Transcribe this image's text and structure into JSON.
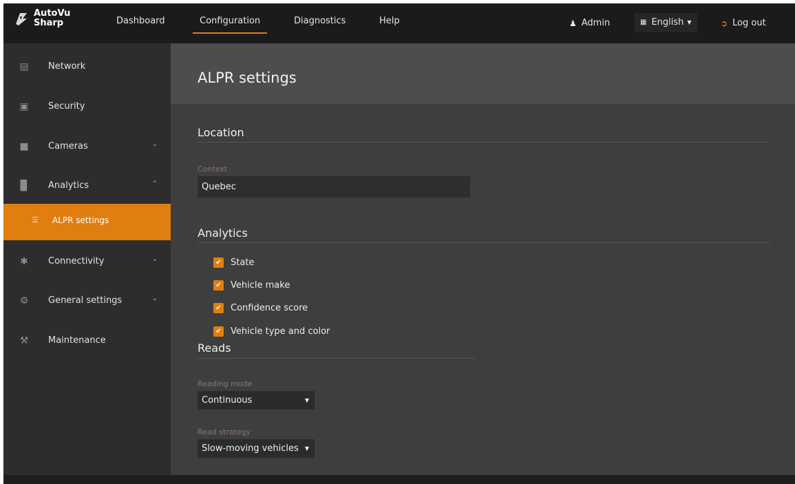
{
  "brand": {
    "line1": "AutoVu",
    "line2": "Sharp"
  },
  "nav": {
    "dashboard": "Dashboard",
    "configuration": "Configuration",
    "diagnostics": "Diagnostics",
    "help": "Help",
    "active": "Configuration"
  },
  "topright": {
    "user": "Admin",
    "language": "English",
    "logout": "Log out"
  },
  "sidebar": {
    "items": [
      {
        "label": "Network",
        "icon": "network-icon"
      },
      {
        "label": "Security",
        "icon": "security-icon"
      },
      {
        "label": "Cameras",
        "icon": "camera-icon",
        "chevron": "down"
      },
      {
        "label": "Analytics",
        "icon": "analytics-icon",
        "chevron": "up"
      },
      {
        "label": "ALPR settings",
        "icon": "sliders-icon",
        "selected": true
      },
      {
        "label": "Connectivity",
        "icon": "connectivity-icon",
        "chevron": "down"
      },
      {
        "label": "General settings",
        "icon": "gear-icon",
        "chevron": "down"
      },
      {
        "label": "Maintenance",
        "icon": "wrench-icon"
      }
    ]
  },
  "main": {
    "title": "ALPR settings",
    "location": {
      "heading": "Location",
      "context_label": "Context",
      "context_value": "Quebec"
    },
    "analytics": {
      "heading": "Analytics",
      "options": [
        {
          "label": "State",
          "checked": true
        },
        {
          "label": "Vehicle make",
          "checked": true
        },
        {
          "label": "Confidence score",
          "checked": true
        },
        {
          "label": "Vehicle type and color",
          "checked": true
        }
      ]
    },
    "reads": {
      "heading": "Reads",
      "reading_mode_label": "Reading mode",
      "reading_mode_value": "Continuous",
      "read_strategy_label": "Read strategy",
      "read_strategy_value": "Slow-moving vehicles"
    }
  },
  "colors": {
    "accent": "#e07f10",
    "topbar": "#1b1b1b",
    "sidebar": "#2d2d2d",
    "main": "#3e3e3e",
    "header": "#4d4d4d"
  }
}
